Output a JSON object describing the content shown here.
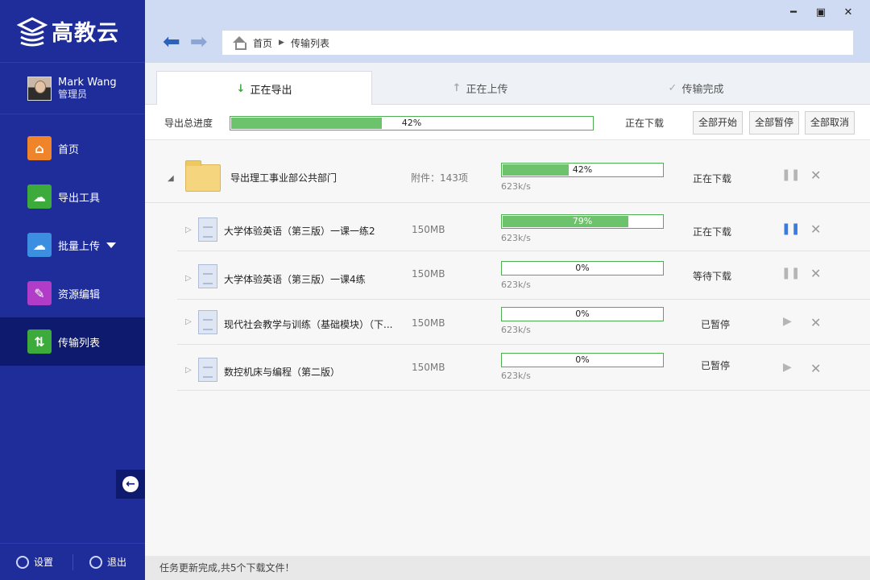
{
  "app": {
    "logo_text": "高教云"
  },
  "user": {
    "name": "Mark Wang",
    "role": "管理员"
  },
  "nav": [
    {
      "label": "首页",
      "icon": "home-icon",
      "color": "#f0842a"
    },
    {
      "label": "导出工具",
      "icon": "download-cloud-icon",
      "color": "#3cab3c"
    },
    {
      "label": "批量上传",
      "icon": "upload-cloud-icon",
      "color": "#3c8ee0"
    },
    {
      "label": "资源编辑",
      "icon": "edit-icon",
      "color": "#b03cc8"
    },
    {
      "label": "传输列表",
      "icon": "transfer-icon",
      "color": "#3cab3c"
    }
  ],
  "footer": {
    "settings": "设置",
    "logout": "退出"
  },
  "window": {
    "minimize": "━",
    "maximize": "▣",
    "close": "✕"
  },
  "breadcrumb": {
    "home": "首页",
    "current": "传输列表"
  },
  "tabs": [
    {
      "label": "正在导出",
      "icon": "↓"
    },
    {
      "label": "正在上传",
      "icon": "↑"
    },
    {
      "label": "传输完成",
      "icon": "✓"
    }
  ],
  "summary": {
    "label": "导出总进度",
    "progress": 42,
    "progress_text": "42%",
    "status": "正在下载",
    "btn_start": "全部开始",
    "btn_pause": "全部暂停",
    "btn_cancel": "全部取消"
  },
  "parent": {
    "name": "导出理工事业部公共部门",
    "attachments": "附件：143项",
    "progress": 42,
    "progress_text": "42%",
    "speed": "623k/s",
    "status": "正在下载"
  },
  "files": [
    {
      "name": "大学体验英语（第三版）一课一练2",
      "size": "150MB",
      "progress": 79,
      "progress_text": "79%",
      "speed": "623k/s",
      "status": "正在下载",
      "action": "pause"
    },
    {
      "name": "大学体验英语（第三版）一课4练",
      "size": "150MB",
      "progress": 0,
      "progress_text": "0%",
      "speed": "623k/s",
      "status": "等待下载",
      "action": "pause"
    },
    {
      "name": "现代社会教学与训练（基础模块）（下...",
      "size": "150MB",
      "progress": 0,
      "progress_text": "0%",
      "speed": "623k/s",
      "status": "已暂停",
      "action": "play"
    },
    {
      "name": "数控机床与编程（第二版）",
      "size": "150MB",
      "progress": 0,
      "progress_text": "0%",
      "speed": "623k/s",
      "status": "已暂停",
      "action": "play"
    }
  ],
  "statusbar": "任务更新完成,共5个下载文件！"
}
